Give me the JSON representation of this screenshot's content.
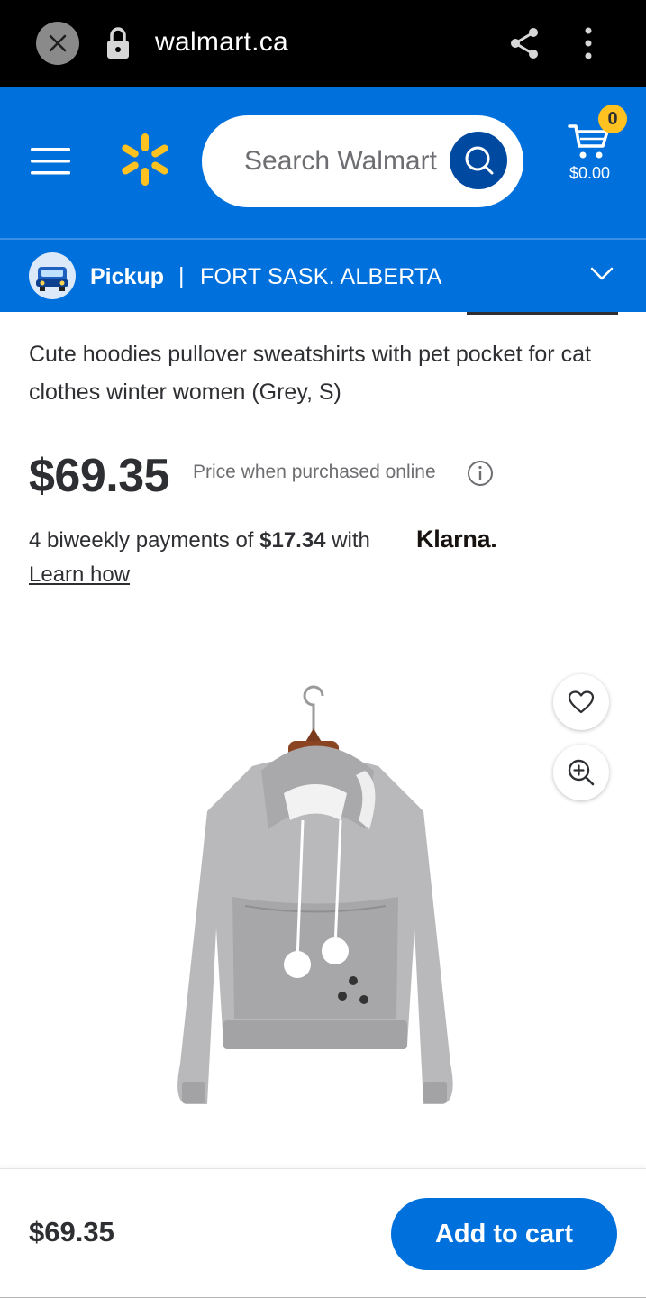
{
  "browser": {
    "url": "walmart.ca"
  },
  "header": {
    "search_placeholder": "Search Walmart",
    "cart_count": "0",
    "cart_total": "$0.00"
  },
  "pickup": {
    "label": "Pickup",
    "separator": "|",
    "location": "FORT SASK. ALBERTA"
  },
  "product": {
    "title": "Cute hoodies pullover sweatshirts with pet pocket for cat clothes winter women (Grey, S)",
    "price": "$69.35",
    "price_note": "Price when purchased online",
    "klarna_prefix": "4 biweekly payments of ",
    "klarna_amount": "$17.34",
    "klarna_suffix": " with ",
    "klarna_brand": "Klarna.",
    "learn_how": "Learn how"
  },
  "bottom": {
    "price": "$69.35",
    "add_to_cart": "Add to cart"
  },
  "colors": {
    "brand_blue": "#0071dc",
    "spark_yellow": "#ffc220",
    "search_button": "#0049a0"
  }
}
